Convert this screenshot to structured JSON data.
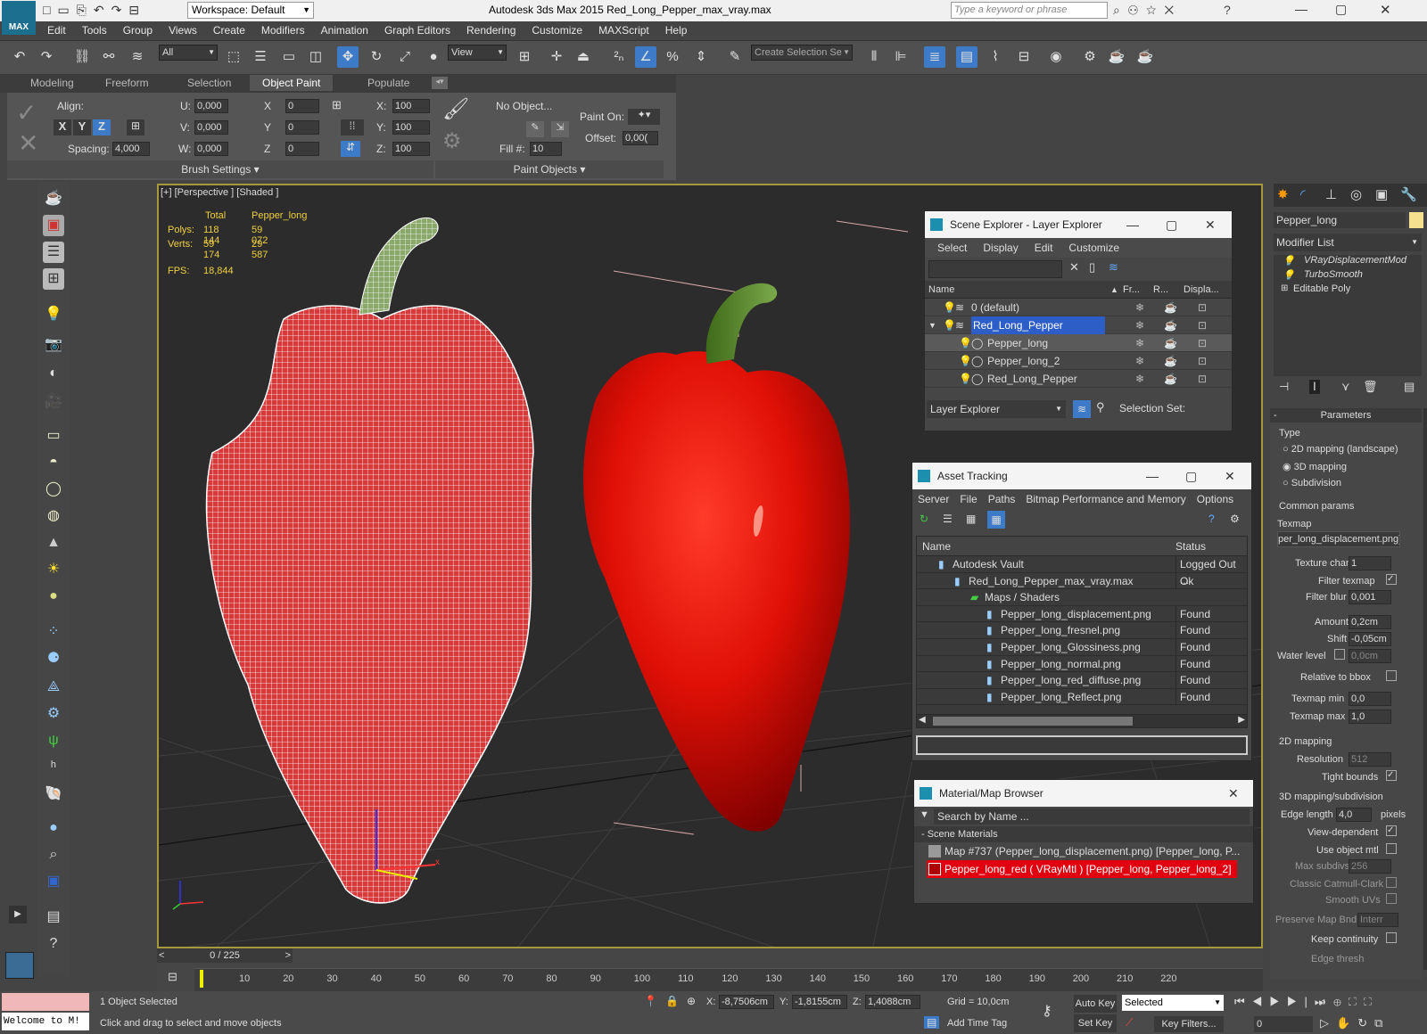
{
  "titlebar": {
    "app_label": "MAX",
    "workspace": "Workspace: Default",
    "title": "Autodesk 3ds Max  2015    Red_Long_Pepper_max_vray.max",
    "search_placeholder": "Type a keyword or phrase"
  },
  "menu": [
    "Edit",
    "Tools",
    "Group",
    "Views",
    "Create",
    "Modifiers",
    "Animation",
    "Graph Editors",
    "Rendering",
    "Customize",
    "MAXScript",
    "Help"
  ],
  "toolbar": {
    "filter": "All",
    "refcoord": "View",
    "selection_set": "Create Selection Se"
  },
  "ribbon": {
    "tabs": [
      "Modeling",
      "Freeform",
      "Selection",
      "Object Paint",
      "Populate"
    ],
    "active_tab": "Object Paint",
    "align_label": "Align:",
    "axes": [
      "X",
      "Y",
      "Z"
    ],
    "spacing_label": "Spacing:",
    "spacing": "4,000",
    "u_label": "U:",
    "u": "0,000",
    "v_label": "V:",
    "v": "0,000",
    "w_label": "W:",
    "w": "0,000",
    "x_label": "X",
    "x": "0",
    "y_label": "Y",
    "y": "0",
    "z_label": "Z",
    "z": "0",
    "sx_label": "X:",
    "sx": "100",
    "sy_label": "Y:",
    "sy": "100",
    "sz_label": "Z:",
    "sz": "100",
    "no_object": "No Object...",
    "fill_label": "Fill #:",
    "fill": "10",
    "paint_on_label": "Paint On:",
    "offset_label": "Offset:",
    "offset": "0,00(",
    "brush_settings": "Brush Settings",
    "paint_objects": "Paint Objects"
  },
  "viewport": {
    "label": "[+] [Perspective ] [Shaded ]",
    "stats": {
      "col_total": "Total",
      "col_obj": "Pepper_long",
      "polys_label": "Polys:",
      "polys_total": "118 144",
      "polys_obj": "59 072",
      "verts_label": "Verts:",
      "verts_total": "59 174",
      "verts_obj": "29 587",
      "fps_label": "FPS:",
      "fps": "18,844"
    }
  },
  "scene_explorer": {
    "title": "Scene Explorer - Layer Explorer",
    "menu": [
      "Select",
      "Display",
      "Edit",
      "Customize"
    ],
    "cols": [
      "Name",
      "Fr...",
      "R...",
      "Displa..."
    ],
    "rows": [
      {
        "name": "0 (default)",
        "indent": 0
      },
      {
        "name": "Red_Long_Pepper",
        "indent": 0,
        "selected": true
      },
      {
        "name": "Pepper_long",
        "indent": 1
      },
      {
        "name": "Pepper_long_2",
        "indent": 1
      },
      {
        "name": "Red_Long_Pepper",
        "indent": 1
      }
    ],
    "footer": "Layer Explorer",
    "selection_set_label": "Selection Set:"
  },
  "asset_tracking": {
    "title": "Asset Tracking",
    "menu": [
      "Server",
      "File",
      "Paths",
      "Bitmap Performance and Memory",
      "Options"
    ],
    "cols": [
      "Name",
      "Status"
    ],
    "rows": [
      {
        "name": "Autodesk Vault",
        "status": "Logged Out ...",
        "indent": 1
      },
      {
        "name": "Red_Long_Pepper_max_vray.max",
        "status": "Ok",
        "indent": 2
      },
      {
        "name": "Maps / Shaders",
        "status": "",
        "indent": 3
      },
      {
        "name": "Pepper_long_displacement.png",
        "status": "Found",
        "indent": 4
      },
      {
        "name": "Pepper_long_fresnel.png",
        "status": "Found",
        "indent": 4
      },
      {
        "name": "Pepper_long_Glossiness.png",
        "status": "Found",
        "indent": 4
      },
      {
        "name": "Pepper_long_normal.png",
        "status": "Found",
        "indent": 4
      },
      {
        "name": "Pepper_long_red_diffuse.png",
        "status": "Found",
        "indent": 4
      },
      {
        "name": "Pepper_long_Reflect.png",
        "status": "Found",
        "indent": 4
      }
    ]
  },
  "material_browser": {
    "title": "Material/Map Browser",
    "search_placeholder": "Search by Name ...",
    "section": "- Scene Materials",
    "items": [
      "Map #737 (Pepper_long_displacement.png) [Pepper_long, P...",
      "Pepper_long_red  ( VRayMtl ) [Pepper_long, Pepper_long_2]"
    ]
  },
  "command_panel": {
    "object_name": "Pepper_long",
    "modifier_list": "Modifier List",
    "stack": [
      "VRayDisplacementMod",
      "TurboSmooth",
      "Editable Poly"
    ],
    "params_title": "Parameters",
    "type_label": "Type",
    "types": [
      "2D mapping (landscape)",
      "3D mapping",
      "Subdivision"
    ],
    "selected_type": "3D mapping",
    "common_params": "Common params",
    "texmap_label": "Texmap",
    "texmap": "per_long_displacement.png)",
    "texture_chan_label": "Texture chan",
    "texture_chan": "1",
    "filter_texmap_label": "Filter texmap",
    "filter_blur_label": "Filter blur",
    "filter_blur": "0,001",
    "amount_label": "Amount",
    "amount": "0,2cm",
    "shift_label": "Shift",
    "shift": "-0,05cm",
    "water_level_label": "Water level",
    "water_level": "0,0cm",
    "relative_bbox_label": "Relative to bbox",
    "texmap_min_label": "Texmap min",
    "texmap_min": "0,0",
    "texmap_max_label": "Texmap max",
    "texmap_max": "1,0",
    "mapping2d": "2D mapping",
    "resolution_label": "Resolution",
    "resolution": "512",
    "tight_bounds_label": "Tight bounds",
    "mapping3d": "3D mapping/subdivision",
    "edge_length_label": "Edge length",
    "edge_length": "4,0",
    "pixels_label": "pixels",
    "view_dependent_label": "View-dependent",
    "use_object_mtl_label": "Use object mtl",
    "max_subdivs_label": "Max subdivs",
    "max_subdivs": "256",
    "catmull_label": "Classic Catmull-Clark",
    "smooth_uvs_label": "Smooth UVs",
    "preserve_label": "Preserve Map Bnd",
    "preserve": "Interr",
    "keep_continuity_label": "Keep continuity",
    "edge_thresh_label": "Edge thresh"
  },
  "timeline": {
    "frame": "0 / 225",
    "ticks": [
      "10",
      "20",
      "30",
      "40",
      "50",
      "60",
      "70",
      "80",
      "90",
      "100",
      "110",
      "120",
      "130",
      "140",
      "150",
      "160",
      "170",
      "180",
      "190",
      "200",
      "210",
      "220"
    ]
  },
  "status": {
    "welcome": "Welcome to M!",
    "selected_msg": "1 Object Selected",
    "hint": "Click and drag to select and move objects",
    "x_label": "X:",
    "x": "-8,7506cm",
    "y_label": "Y:",
    "y": "-1,8155cm",
    "z_label": "Z:",
    "z": "1,4088cm",
    "grid": "Grid = 10,0cm",
    "add_time_tag": "Add Time Tag",
    "auto_key": "Auto Key",
    "set_key": "Set Key",
    "selected_dd": "Selected",
    "key_filters": "Key Filters...",
    "frame_field": "0"
  }
}
